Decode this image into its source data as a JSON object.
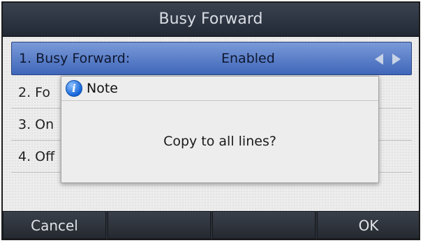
{
  "header": {
    "title": "Busy Forward"
  },
  "list": {
    "items": [
      {
        "label": "1. Busy Forward:",
        "value": "Enabled"
      },
      {
        "label": "2. Fo"
      },
      {
        "label": "3. On"
      },
      {
        "label": "4. Off"
      }
    ]
  },
  "dialog": {
    "icon": "info-icon",
    "icon_glyph": "i",
    "title": "Note",
    "message": "Copy to all lines?"
  },
  "softkeys": [
    "Cancel",
    "",
    "",
    "OK"
  ]
}
